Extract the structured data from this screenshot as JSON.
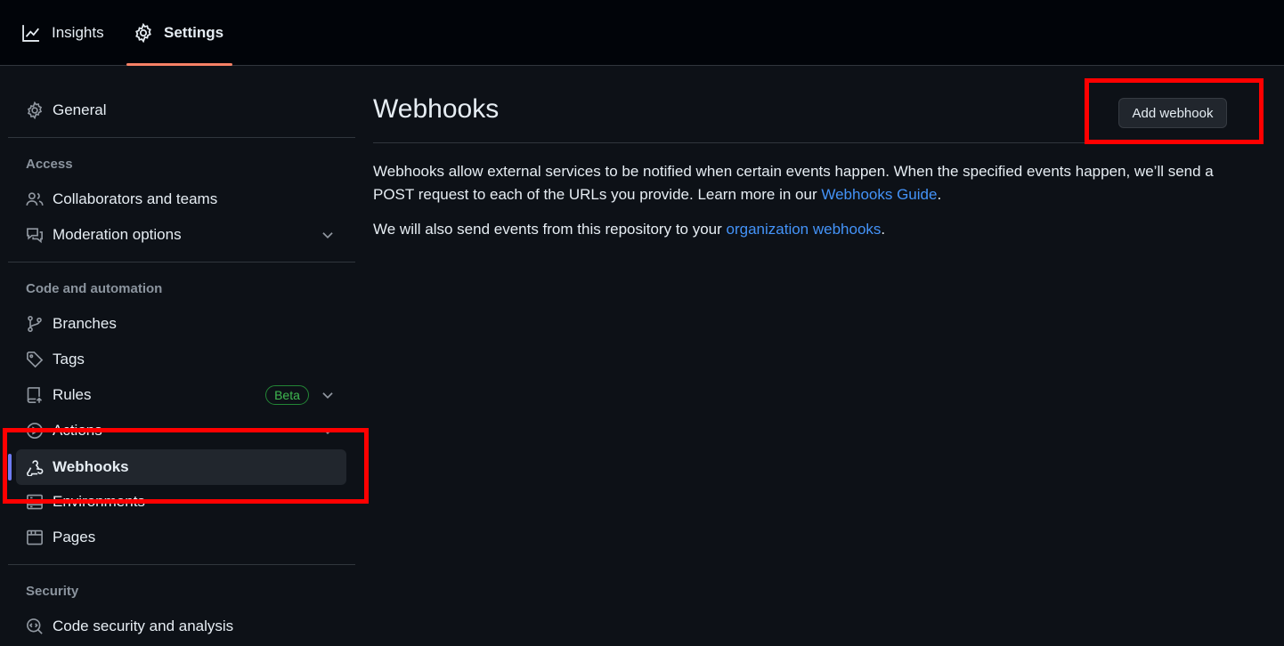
{
  "topbar": {
    "tabs": [
      {
        "label": "Insights",
        "icon": "graph-icon"
      },
      {
        "label": "Settings",
        "icon": "gear-icon",
        "selected": true
      }
    ]
  },
  "sidebar": {
    "general": {
      "label": "General",
      "icon": "gear-icon"
    },
    "sections": {
      "access": "Access",
      "code_automation": "Code and automation",
      "security": "Security"
    },
    "items": {
      "collaborators": "Collaborators and teams",
      "moderation": "Moderation options",
      "branches": "Branches",
      "tags": "Tags",
      "rules": "Rules",
      "rules_badge": "Beta",
      "actions": "Actions",
      "webhooks": "Webhooks",
      "environments": "Environments",
      "pages": "Pages",
      "code_security": "Code security and analysis"
    },
    "active_item": "Webhooks"
  },
  "main": {
    "title": "Webhooks",
    "add_button": "Add webhook",
    "description_part1": "Webhooks allow external services to be notified when certain events happen. When the specified events happen, we’ll send a POST request to each of the URLs you provide. Learn more in our ",
    "description_link": "Webhooks Guide",
    "description_part2": ".",
    "org_text": "We will also send events from this repository to your ",
    "org_link": "organization webhooks",
    "org_text_end": "."
  },
  "colors": {
    "accent_underline": "#f78166",
    "link": "#4493f8",
    "highlight": "#ff0000",
    "beta": "#3fb950"
  }
}
